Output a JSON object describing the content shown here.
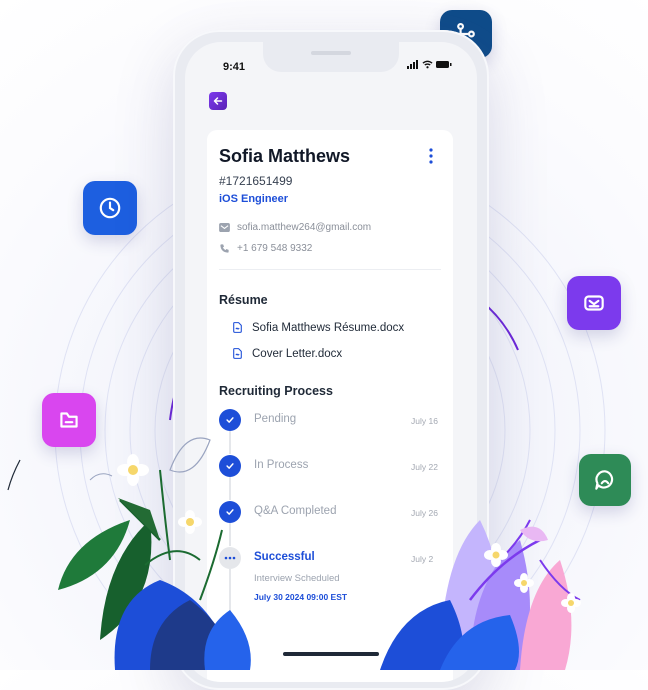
{
  "status": {
    "time": "9:41"
  },
  "candidate": {
    "name": "Sofia Matthews",
    "id": "#1721651499",
    "role": "iOS Engineer",
    "email": "sofia.matthew264@gmail.com",
    "phone": "+1 679 548 9332"
  },
  "resume": {
    "title": "Résume",
    "files": [
      "Sofia Matthews Résume.docx",
      "Cover Letter.docx"
    ]
  },
  "process": {
    "title": "Recruiting Process",
    "steps": [
      {
        "label": "Pending",
        "date": "July 16"
      },
      {
        "label": "In Process",
        "date": "July 22"
      },
      {
        "label": "Q&A Completed",
        "date": "July 26"
      },
      {
        "label": "Successful",
        "date": "July 2"
      }
    ],
    "note": "Interview Scheduled",
    "schedule": "July 30 2024  09:00 EST"
  },
  "colors": {
    "accent": "#1d4ed8",
    "purple": "#7c3aed",
    "magenta": "#d946ef",
    "green": "#2e8b57"
  },
  "icons": {
    "top": "branch-icon",
    "left": "clock-icon",
    "right": "inbox-icon",
    "left_low": "folder-icon",
    "right_low": "chat-icon"
  }
}
